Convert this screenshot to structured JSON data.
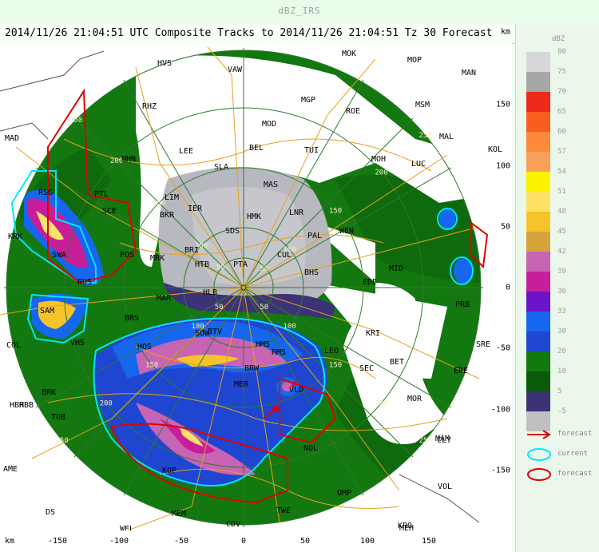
{
  "window": {
    "title": "dBZ_IRS"
  },
  "header": {
    "title": "2014/11/26 21:04:51 UTC Composite Tracks to 2014/11/26 21:04:51 Tz 30 Forecast"
  },
  "axes": {
    "unit": "km",
    "x_ticks": [
      "-150",
      "-100",
      "-50",
      "0",
      "50",
      "100",
      "150"
    ],
    "y_ticks": [
      "150",
      "100",
      "50",
      "0",
      "-50",
      "-100",
      "-150"
    ]
  },
  "ring_labels": [
    "50",
    "100",
    "150",
    "200",
    "250"
  ],
  "stations": [
    "MOK",
    "MOP",
    "MAN",
    "VAW",
    "MGP",
    "ROE",
    "MSM",
    "MAL",
    "HVS",
    "MOD",
    "RHZ",
    "MAD",
    "BEL",
    "TUI",
    "MOH",
    "LUC",
    "KOL",
    "NHN",
    "LEE",
    "SLA",
    "RSG",
    "PTL",
    "LIM",
    "MAS",
    "BKR",
    "IER",
    "HMK",
    "LNR",
    "PAL",
    "WEN",
    "KRK",
    "SCE",
    "SDS",
    "BRI",
    "SWA",
    "POS",
    "MRK",
    "CUL",
    "HTB",
    "PTA",
    "BHS",
    "MID",
    "RUS",
    "HLB",
    "EDE",
    "SAM",
    "BRS",
    "MAR",
    "VHS",
    "SOW",
    "KRI",
    "COL",
    "RMS",
    "LEO",
    "SEC",
    "BET",
    "BRK",
    "MER",
    "HBB",
    "TOB",
    "MOR",
    "HBR",
    "MAM",
    "HMS",
    "VLO",
    "MEH",
    "NOL",
    "BRW",
    "HOS",
    "CLY",
    "AME",
    "DS",
    "BTV",
    "WEL",
    "KRO",
    "MEM",
    "CDV",
    "PRB",
    "SRE",
    "ERE",
    "KOP",
    "VOL",
    "OMP",
    "TWE"
  ],
  "legend": {
    "unit": "dBZ",
    "scale": [
      {
        "label": "80",
        "color": "#d7d7d7"
      },
      {
        "label": "75",
        "color": "#a7a7a7"
      },
      {
        "label": "70",
        "color": "#ee2a1a"
      },
      {
        "label": "65",
        "color": "#fa5e1e"
      },
      {
        "label": "60",
        "color": "#fd8a3c"
      },
      {
        "label": "57",
        "color": "#f9a05a"
      },
      {
        "label": "54",
        "color": "#fdf200"
      },
      {
        "label": "51",
        "color": "#fde266"
      },
      {
        "label": "48",
        "color": "#f5c42a"
      },
      {
        "label": "45",
        "color": "#d4a43a"
      },
      {
        "label": "42",
        "color": "#c864b4"
      },
      {
        "label": "39",
        "color": "#c81e9a"
      },
      {
        "label": "36",
        "color": "#6a14c8"
      },
      {
        "label": "33",
        "color": "#1666f0"
      },
      {
        "label": "30",
        "color": "#1e46d0"
      },
      {
        "label": "20",
        "color": "#13780f"
      },
      {
        "label": "10",
        "color": "#0b5a0b"
      },
      {
        "label": "5",
        "color": "#3c3276"
      },
      {
        "label": "-5",
        "color": "#c0c0c0"
      }
    ],
    "items": [
      {
        "label": "forecast",
        "kind": "arrow",
        "color": "#e00000"
      },
      {
        "label": "current",
        "kind": "ellipse",
        "color": "#00e5ff"
      },
      {
        "label": "forecast",
        "kind": "ellipse",
        "color": "#e00000"
      }
    ]
  }
}
